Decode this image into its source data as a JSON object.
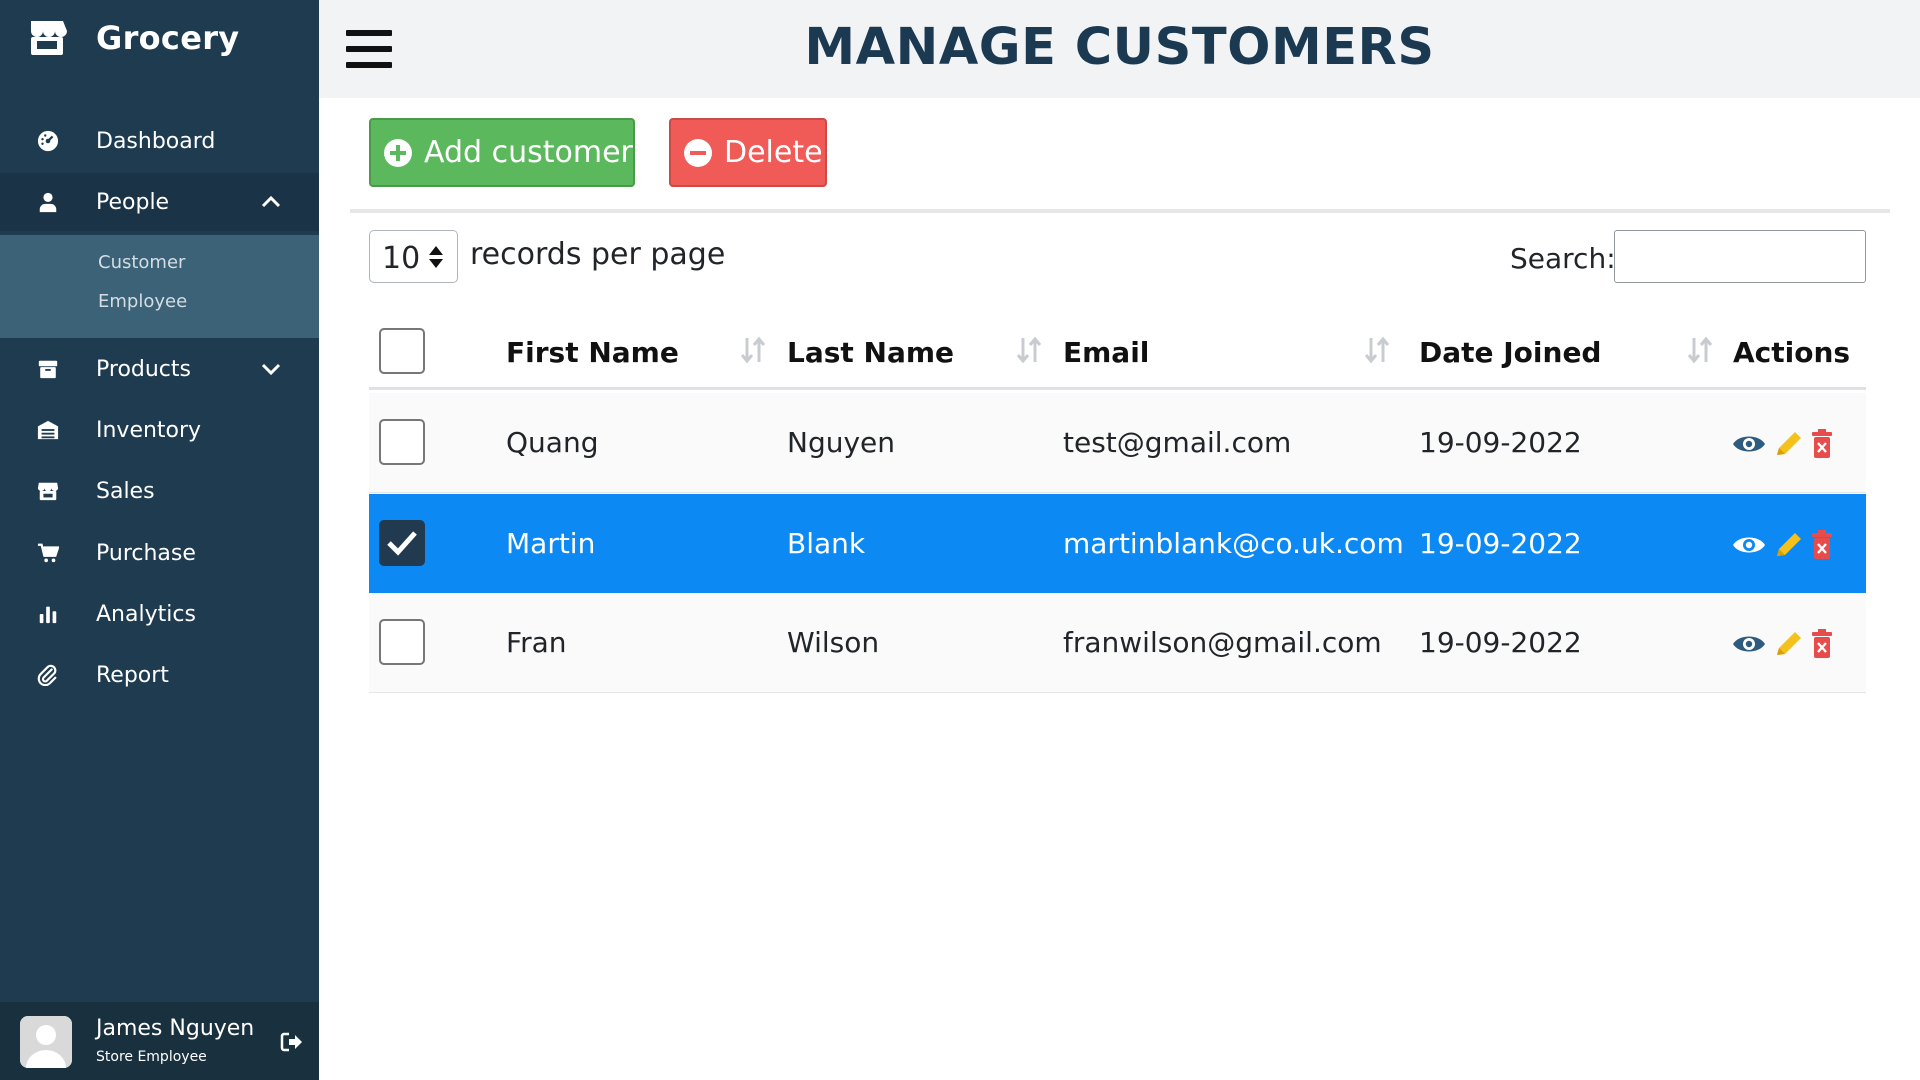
{
  "sidebar": {
    "brand": "Grocery",
    "items": [
      {
        "label": "Dashboard",
        "icon": "dashboard-gauge-icon"
      },
      {
        "label": "People",
        "icon": "person-icon",
        "expanded": true
      },
      {
        "label": "Products",
        "icon": "box-icon",
        "expanded": false
      },
      {
        "label": "Inventory",
        "icon": "warehouse-icon"
      },
      {
        "label": "Sales",
        "icon": "store-icon"
      },
      {
        "label": "Purchase",
        "icon": "cart-icon"
      },
      {
        "label": "Analytics",
        "icon": "bar-chart-icon"
      },
      {
        "label": "Report",
        "icon": "paperclip-icon"
      }
    ],
    "people_submenu": [
      "Customer",
      "Employee"
    ],
    "user": {
      "name": "James Nguyen",
      "role": "Store Employee"
    }
  },
  "header": {
    "title": "MANAGE CUSTOMERS"
  },
  "toolbar": {
    "add_label": "Add customer",
    "delete_label": "Delete"
  },
  "table_controls": {
    "page_size": "10",
    "page_size_suffix": "records per page",
    "search_label": "Search:",
    "search_value": ""
  },
  "table": {
    "columns": [
      "First Name",
      "Last Name",
      "Email",
      "Date Joined",
      "Actions"
    ],
    "rows": [
      {
        "first": "Quang",
        "last": "Nguyen",
        "email": "test@gmail.com",
        "joined": "19-09-2022",
        "selected": false
      },
      {
        "first": "Martin",
        "last": "Blank",
        "email": "martinblank@co.uk.com",
        "joined": "19-09-2022",
        "selected": true
      },
      {
        "first": "Fran",
        "last": "Wilson",
        "email": "franwilson@gmail.com",
        "joined": "19-09-2022",
        "selected": false
      }
    ],
    "action_icons": [
      "eye-icon",
      "pencil-icon",
      "trash-icon"
    ]
  },
  "colors": {
    "sidebar": "#1f3b50",
    "submenu": "#3b6276",
    "selected_row": "#0d89f3",
    "add_button": "#5cb85c",
    "delete_button": "#f05a57",
    "title": "#1b3a52",
    "view_icon": "#2f5c7e",
    "edit_icon": "#f4c21a",
    "delete_icon": "#e84b4b"
  }
}
